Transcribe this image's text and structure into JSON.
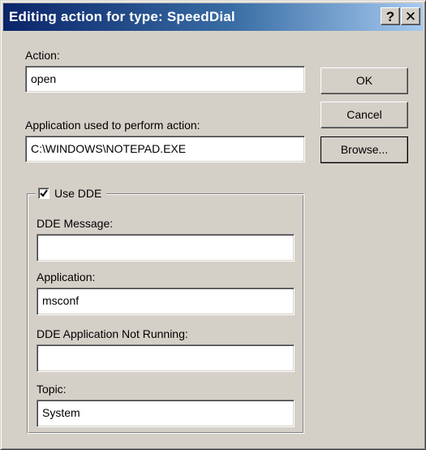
{
  "window": {
    "title": "Editing action for type: SpeedDial",
    "help_glyph": "?",
    "close_glyph": "✕"
  },
  "action": {
    "label": "Action:",
    "value": "open"
  },
  "application_used": {
    "label": "Application used to perform action:",
    "value": "C:\\WINDOWS\\NOTEPAD.EXE"
  },
  "buttons": {
    "ok": "OK",
    "cancel": "Cancel",
    "browse": "Browse..."
  },
  "dde": {
    "checkbox_label": "Use DDE",
    "checked": true,
    "message": {
      "label": "DDE Message:",
      "value": ""
    },
    "application": {
      "label": "Application:",
      "value": "msconf"
    },
    "not_running": {
      "label": "DDE Application Not Running:",
      "value": ""
    },
    "topic": {
      "label": "Topic:",
      "value": "System"
    }
  },
  "colors": {
    "face": "#d4d0c8",
    "title_start": "#0a246a",
    "title_end": "#a6caf0"
  },
  "icons": {
    "checkmark": "checkmark-icon",
    "help": "help-icon",
    "close": "close-icon"
  }
}
